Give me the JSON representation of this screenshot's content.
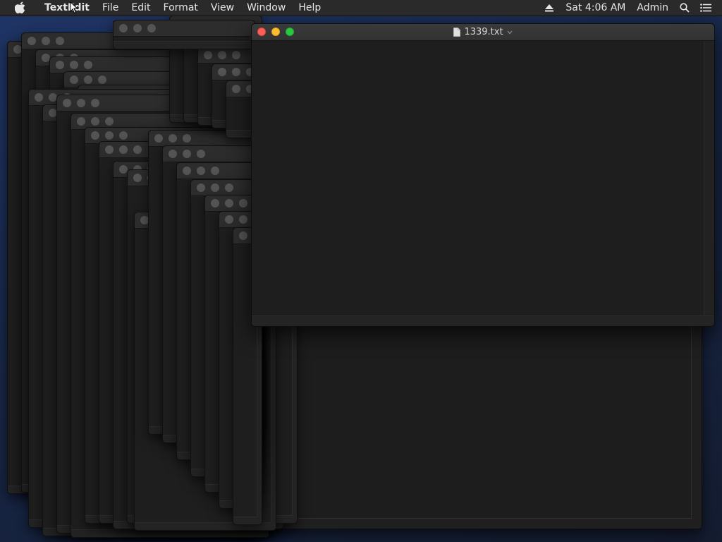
{
  "menubar": {
    "apple_icon": "apple-icon",
    "app_name": "TextEdit",
    "menus": [
      "File",
      "Edit",
      "Format",
      "View",
      "Window",
      "Help"
    ],
    "eject_icon": "eject-icon",
    "clock": "Sat 4:06 AM",
    "user": "Admin",
    "search_icon": "spotlight-search-icon",
    "notification_icon": "notification-center-icon"
  },
  "front_window": {
    "title": "1339.txt",
    "doc_icon": "document-icon",
    "title_menu_icon": "chevron-down-icon"
  },
  "colors": {
    "close": "#fe5f57",
    "minimize": "#febc2e",
    "zoom": "#28c840",
    "inactive_dot": "#545454",
    "window_bg": "#1e1e1e",
    "menubar_bg": "#2a2a2a"
  }
}
